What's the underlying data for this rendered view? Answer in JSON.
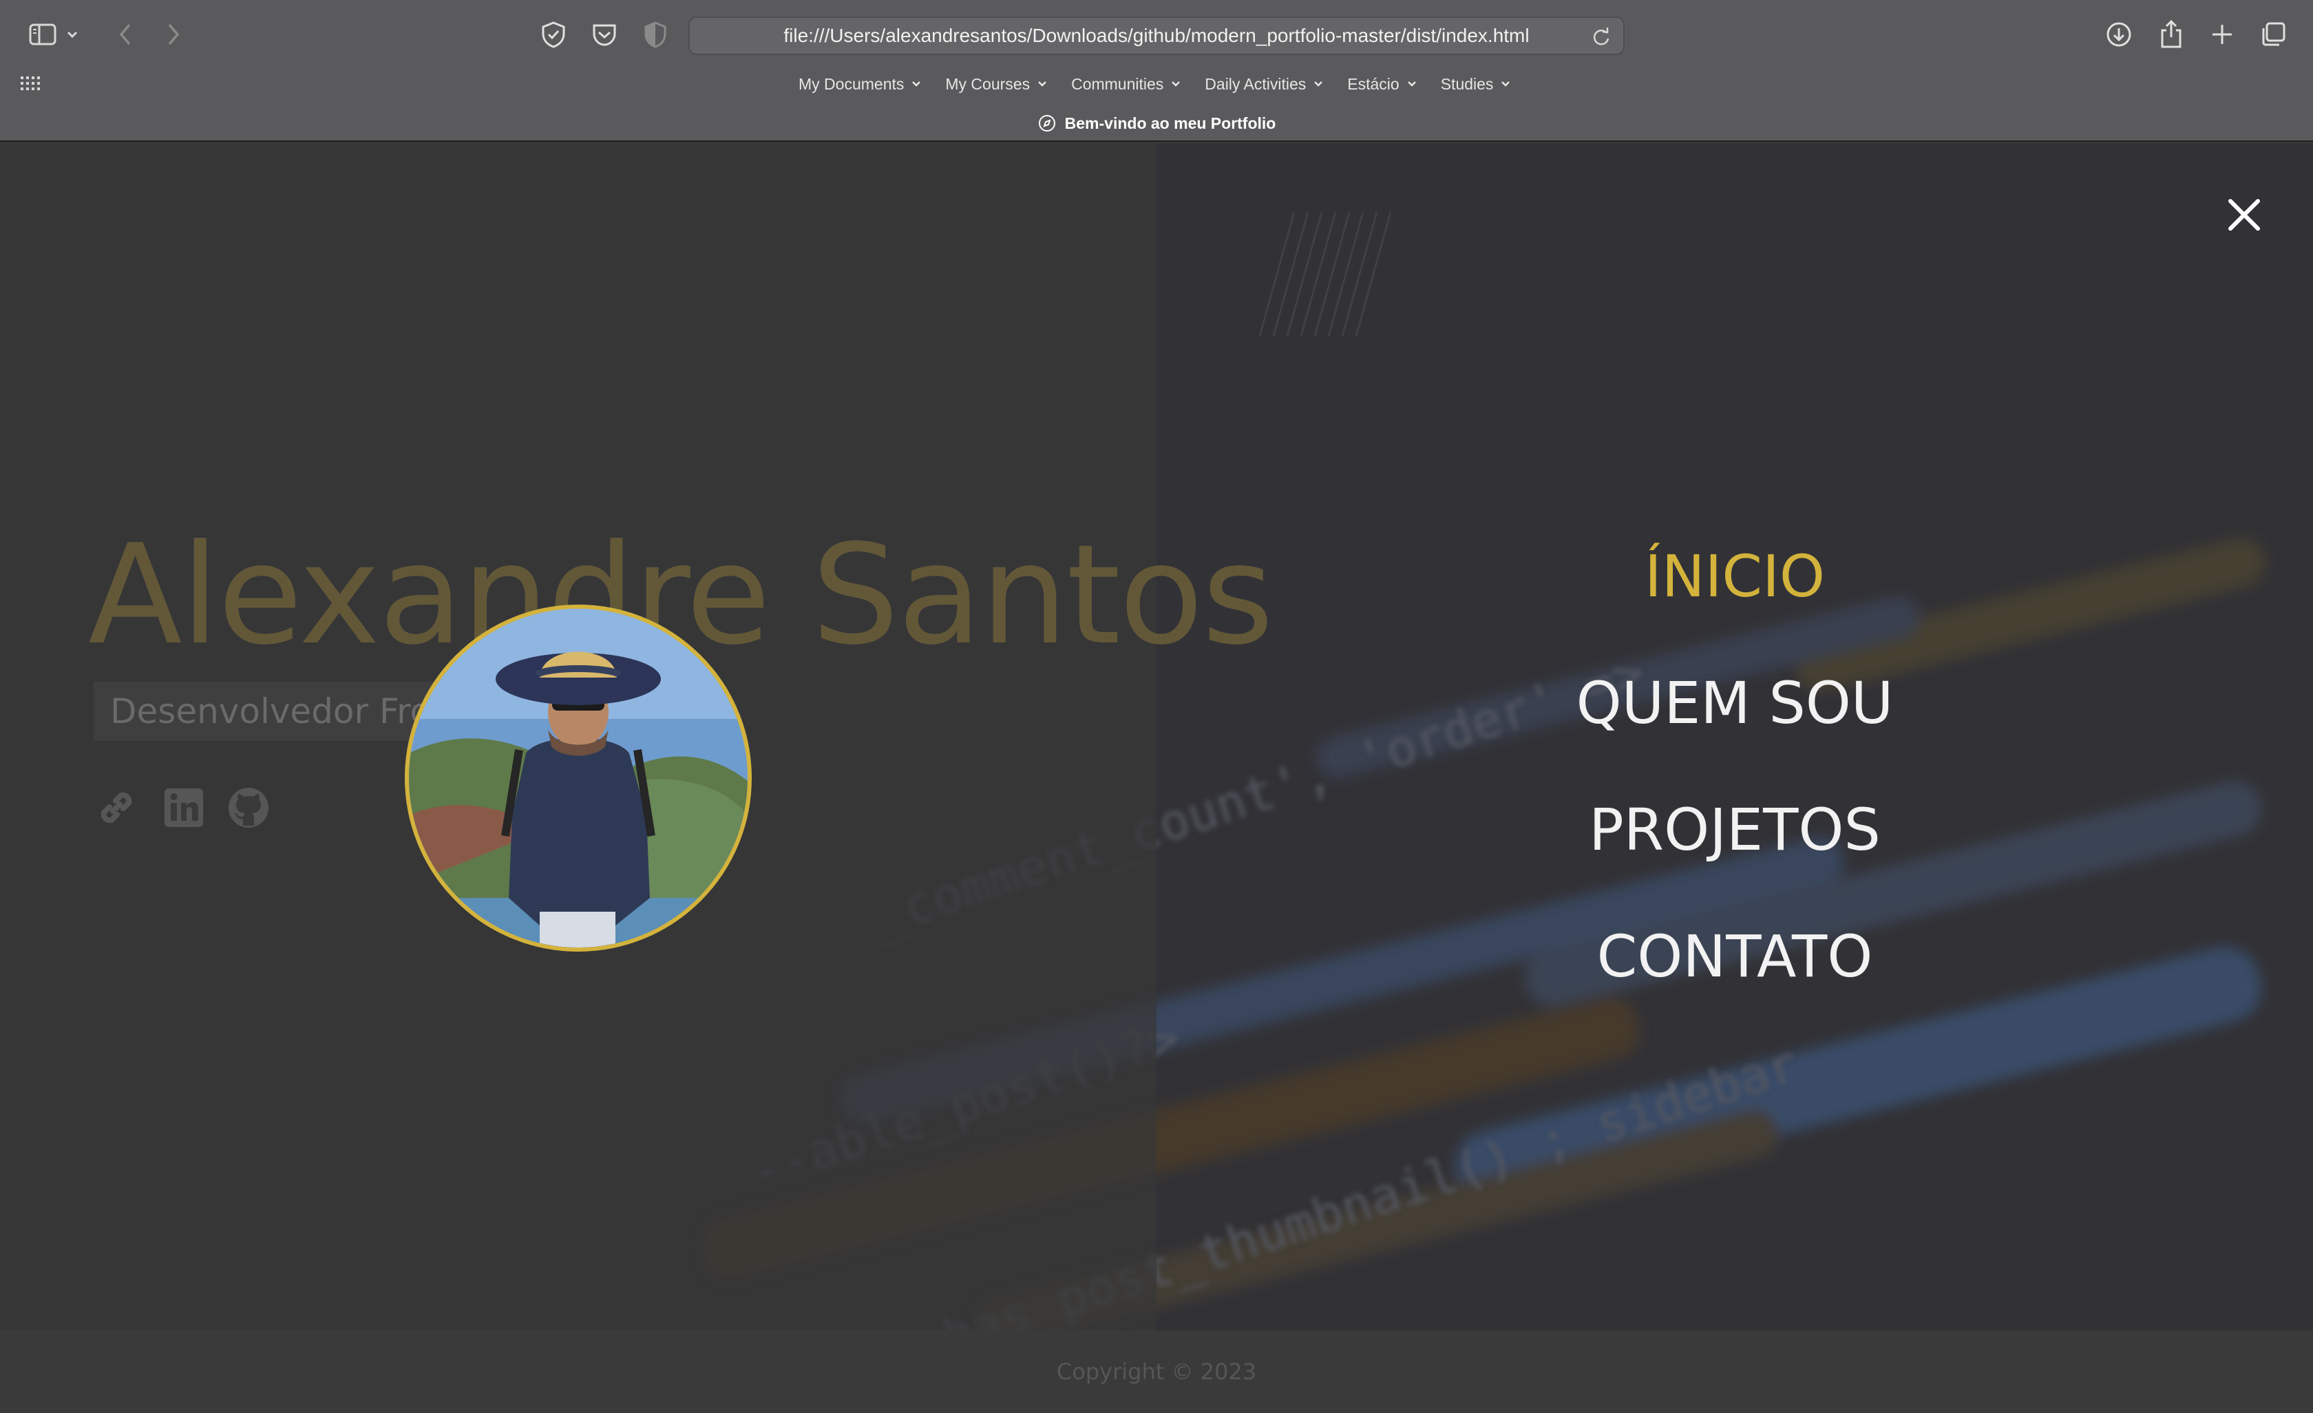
{
  "browser": {
    "url": "file:///Users/alexandresantos/Downloads/github/modern_portfolio-master/dist/index.html",
    "bookmarks": [
      {
        "label": "My Documents"
      },
      {
        "label": "My Courses"
      },
      {
        "label": "Communities"
      },
      {
        "label": "Daily Activities"
      },
      {
        "label": "Estácio"
      },
      {
        "label": "Studies"
      }
    ],
    "tab_title": "Bem-vindo ao meu Portfolio"
  },
  "hero": {
    "name": "Alexandre Santos",
    "role": "Desenvolvedor Front-End",
    "social_icons": [
      "link-icon",
      "linkedin-icon",
      "github-icon"
    ]
  },
  "menu": {
    "items": [
      {
        "label": "ÍNICIO",
        "active": true
      },
      {
        "label": "QUEM SOU",
        "active": false
      },
      {
        "label": "PROJETOS",
        "active": false
      },
      {
        "label": "CONTATO",
        "active": false
      }
    ]
  },
  "footer": {
    "copyright": "Copyright © 2023"
  },
  "colors": {
    "accent": "#d4b33c",
    "menu_text": "#f2f2f2",
    "chrome_bg": "#5a5a5c"
  }
}
